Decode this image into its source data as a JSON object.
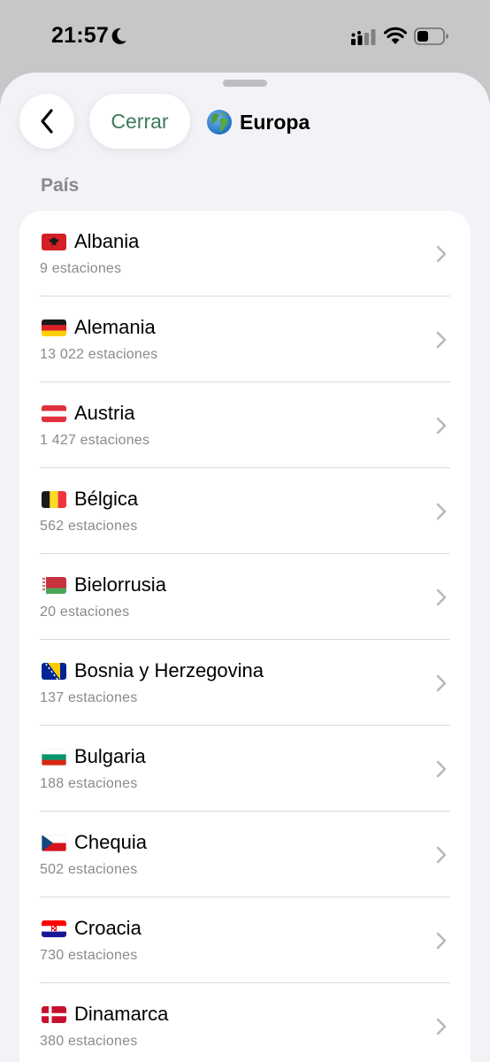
{
  "status_bar": {
    "time": "21:57"
  },
  "header": {
    "back_icon": "chevron-left-icon",
    "close_label": "Cerrar",
    "title_icon": "globe-icon",
    "title": "Europa",
    "accent_color": "#3c7a5a"
  },
  "section": {
    "label": "País"
  },
  "countries": [
    {
      "flag": "albania-flag-icon",
      "name": "Albania",
      "stations": "9 estaciones"
    },
    {
      "flag": "germany-flag-icon",
      "name": "Alemania",
      "stations": "13 022 estaciones"
    },
    {
      "flag": "austria-flag-icon",
      "name": "Austria",
      "stations": "1 427 estaciones"
    },
    {
      "flag": "belgium-flag-icon",
      "name": "Bélgica",
      "stations": "562 estaciones"
    },
    {
      "flag": "belarus-flag-icon",
      "name": "Bielorrusia",
      "stations": "20 estaciones"
    },
    {
      "flag": "bosnia-flag-icon",
      "name": "Bosnia y Herzegovina",
      "stations": "137 estaciones"
    },
    {
      "flag": "bulgaria-flag-icon",
      "name": "Bulgaria",
      "stations": "188 estaciones"
    },
    {
      "flag": "czechia-flag-icon",
      "name": "Chequia",
      "stations": "502 estaciones"
    },
    {
      "flag": "croatia-flag-icon",
      "name": "Croacia",
      "stations": "730 estaciones"
    },
    {
      "flag": "denmark-flag-icon",
      "name": "Dinamarca",
      "stations": "380 estaciones"
    }
  ]
}
